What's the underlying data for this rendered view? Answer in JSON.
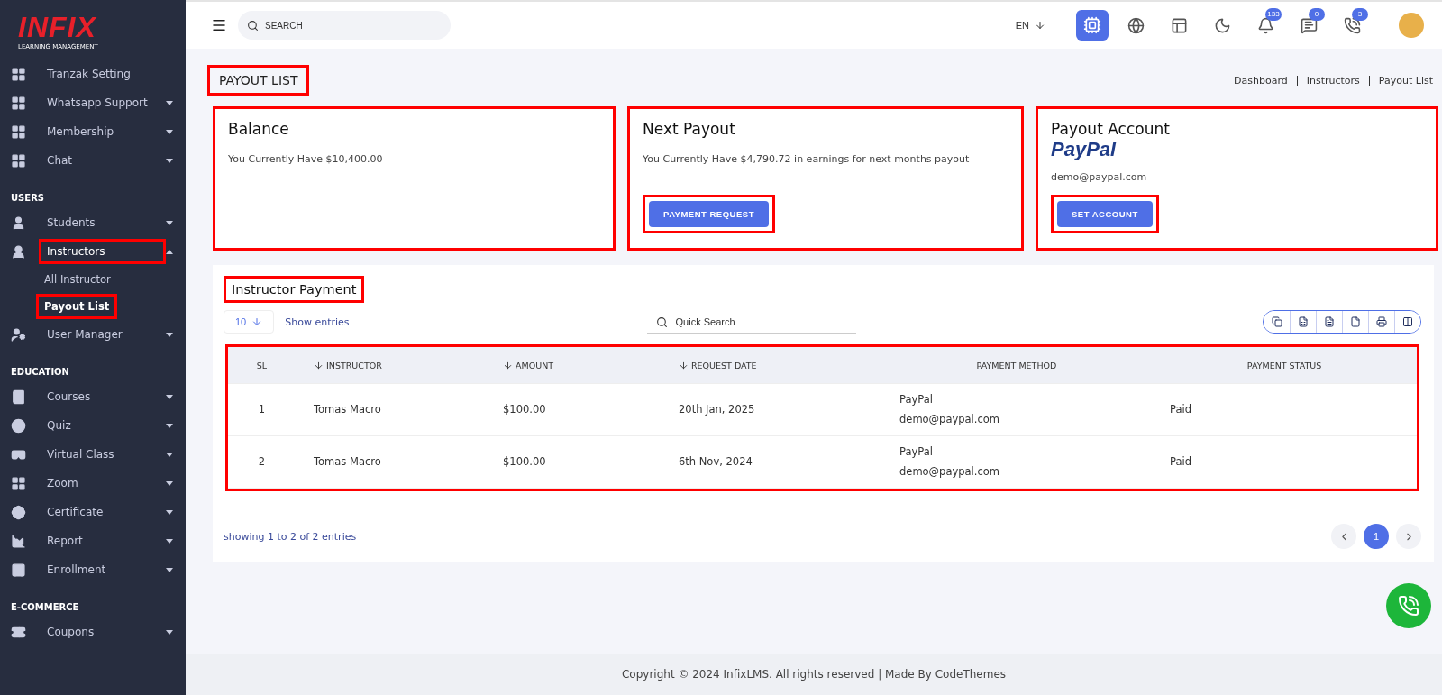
{
  "logo": {
    "mark": "INFIX",
    "tagline": "LEARNING MANAGEMENT"
  },
  "sidebar": {
    "sections": [
      {
        "items": [
          {
            "label": "Tranzak Setting",
            "kind": "link",
            "expanded": false,
            "highlighted": false
          },
          {
            "label": "Whatsapp Support",
            "kind": "menu",
            "expanded": false,
            "highlighted": false
          },
          {
            "label": "Membership",
            "kind": "menu",
            "expanded": false,
            "highlighted": false
          },
          {
            "label": "Chat",
            "kind": "menu",
            "expanded": false,
            "highlighted": false
          }
        ]
      },
      {
        "title": "USERS",
        "items": [
          {
            "label": "Students",
            "kind": "menu",
            "expanded": false,
            "highlighted": false
          },
          {
            "label": "Instructors",
            "kind": "menu",
            "expanded": true,
            "highlighted": true,
            "children": [
              {
                "label": "All Instructor",
                "selected": false,
                "highlighted": false
              },
              {
                "label": "Payout List",
                "selected": true,
                "highlighted": true
              }
            ]
          },
          {
            "label": "User Manager",
            "kind": "menu",
            "expanded": false,
            "highlighted": false
          }
        ]
      },
      {
        "title": "EDUCATION",
        "items": [
          {
            "label": "Courses",
            "kind": "menu",
            "expanded": false,
            "highlighted": false
          },
          {
            "label": "Quiz",
            "kind": "menu",
            "expanded": false,
            "highlighted": false
          },
          {
            "label": "Virtual Class",
            "kind": "menu",
            "expanded": false,
            "highlighted": false
          },
          {
            "label": "Zoom",
            "kind": "menu",
            "expanded": false,
            "highlighted": false
          },
          {
            "label": "Certificate",
            "kind": "menu",
            "expanded": false,
            "highlighted": false
          },
          {
            "label": "Report",
            "kind": "menu",
            "expanded": false,
            "highlighted": false
          },
          {
            "label": "Enrollment",
            "kind": "menu",
            "expanded": false,
            "highlighted": false
          }
        ]
      },
      {
        "title": "E-COMMERCE",
        "items": [
          {
            "label": "Coupons",
            "kind": "menu",
            "expanded": false,
            "highlighted": false
          }
        ]
      }
    ]
  },
  "topbar": {
    "search": {
      "placeholder": "SEARCH"
    },
    "language": "EN",
    "badges": [
      "133",
      "0",
      "3"
    ]
  },
  "page": {
    "title": "PAYOUT LIST",
    "title_highlighted": true,
    "breadcrumbs": [
      "Dashboard",
      "Instructors",
      "Payout List"
    ]
  },
  "cards": [
    {
      "kind": "balance",
      "title": "Balance",
      "text": "You Currently Have $10,400.00",
      "highlighted": true
    },
    {
      "kind": "payout",
      "title": "Next Payout",
      "text": "You Currently Have $4,790.72 in earnings for next months payout",
      "button": "PAYMENT REQUEST",
      "button_highlighted": true,
      "highlighted": true
    },
    {
      "kind": "account",
      "title": "Payout Account",
      "brand": "PayPal",
      "text": "demo@paypal.com",
      "button": "SET ACCOUNT",
      "button_highlighted": true,
      "highlighted": true
    }
  ],
  "table_card": {
    "title": "Instructor Payment",
    "title_highlighted": true,
    "page_size": "10",
    "page_size_label": "Show entries",
    "search_placeholder": "Quick Search",
    "table_highlighted": true,
    "columns": [
      {
        "label": "SL",
        "sortable": false
      },
      {
        "label": "INSTRUCTOR",
        "sortable": true
      },
      {
        "label": "AMOUNT",
        "sortable": true
      },
      {
        "label": "REQUEST DATE",
        "sortable": true
      },
      {
        "label": "PAYMENT METHOD",
        "sortable": false
      },
      {
        "label": "PAYMENT STATUS",
        "sortable": false
      }
    ],
    "rows": [
      {
        "sl": "1",
        "instructor": "Tomas Macro",
        "amount": "$100.00",
        "date": "20th Jan, 2025",
        "method": "PayPal",
        "account": "demo@paypal.com",
        "status": "Paid"
      },
      {
        "sl": "2",
        "instructor": "Tomas Macro",
        "amount": "$100.00",
        "date": "6th Nov, 2024",
        "method": "PayPal",
        "account": "demo@paypal.com",
        "status": "Paid"
      }
    ],
    "summary": "showing 1 to 2 of 2 entries",
    "pages": [
      {
        "label": "1",
        "selected": true
      }
    ]
  },
  "footer": "Copyright © 2024 InfixLMS. All rights reserved | Made By CodeThemes"
}
